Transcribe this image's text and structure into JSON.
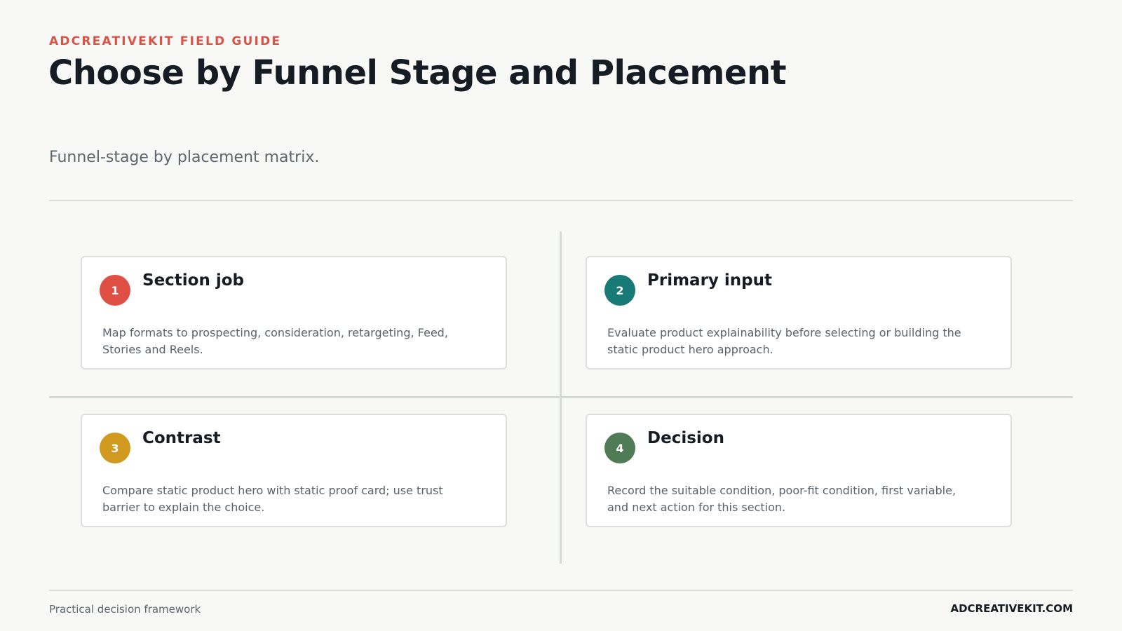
{
  "header": {
    "eyebrow": "ADCREATIVEKIT FIELD GUIDE",
    "title": "Choose by Funnel Stage and Placement",
    "subtitle": "Funnel-stage by placement matrix."
  },
  "colors": {
    "accent": "#d95445",
    "step1": "#e04f43",
    "step2": "#177a76",
    "step3": "#d0991f",
    "step4": "#4f7c55"
  },
  "cards": [
    {
      "number": "1",
      "title": "Section job",
      "body": "Map formats to prospecting, consideration, retargeting, Feed, Stories and Reels."
    },
    {
      "number": "2",
      "title": "Primary input",
      "body": "Evaluate product explainability before selecting or building the static product hero approach."
    },
    {
      "number": "3",
      "title": "Contrast",
      "body": "Compare static product hero with static proof card; use trust barrier to explain the choice."
    },
    {
      "number": "4",
      "title": "Decision",
      "body": "Record the suitable condition, poor-fit condition, first variable, and next action for this section."
    }
  ],
  "footer": {
    "left": "Practical decision framework",
    "right": "ADCREATIVEKIT.COM"
  }
}
